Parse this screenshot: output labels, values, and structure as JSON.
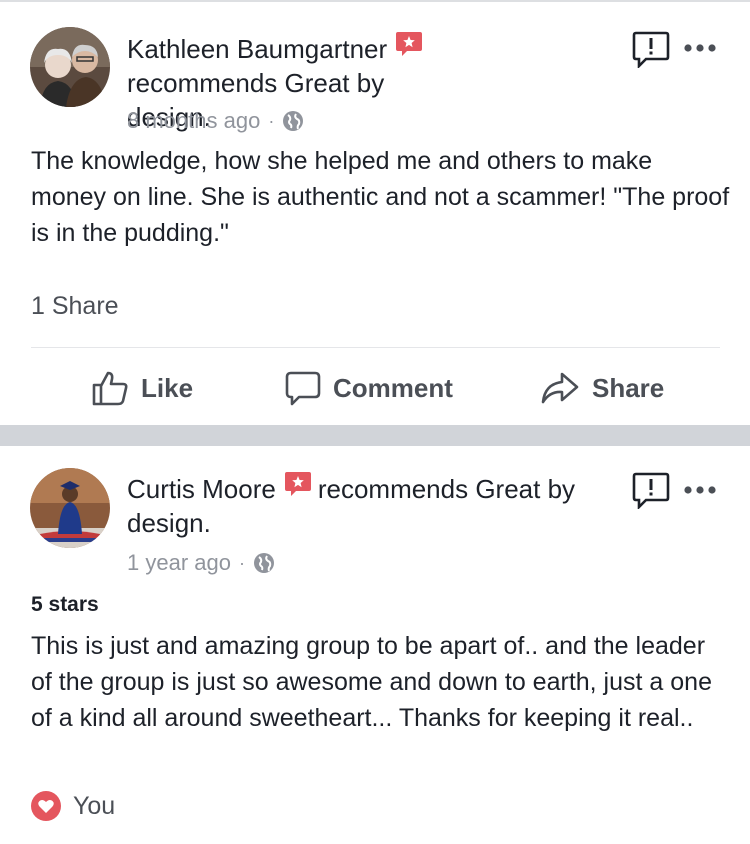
{
  "posts": [
    {
      "author": "Kathleen Baumgartner",
      "action_text": "recommends Great by design.",
      "time": "8 months ago",
      "body": "The knowledge, how she helped me and others to make money on line. She is authentic and not a scammer! \"The proof is in the pudding.\"",
      "shares": "1 Share",
      "actions": {
        "like": "Like",
        "comment": "Comment",
        "share": "Share"
      }
    },
    {
      "author": "Curtis Moore",
      "action_text": "recommends Great by design.",
      "time": "1 year ago",
      "rating_label": "5 stars",
      "body": "This is just and amazing group to be apart of.. and the leader of the group is just so awesome and down to earth,  just a one of a kind all around sweetheart... Thanks for keeping it real..",
      "reaction_label": "You"
    }
  ],
  "icons": {
    "recommend": "recommend-badge-icon",
    "globe": "globe-icon",
    "report": "report-icon",
    "more": "more-options-icon",
    "like": "thumbs-up-icon",
    "comment": "comment-bubble-icon",
    "share": "share-arrow-icon",
    "heart": "heart-reaction-icon"
  },
  "colors": {
    "recommend_badge": "#e4565e",
    "heart": "#e4565e",
    "muted_text": "#90949c",
    "divider_band": "#d1d4d9"
  }
}
